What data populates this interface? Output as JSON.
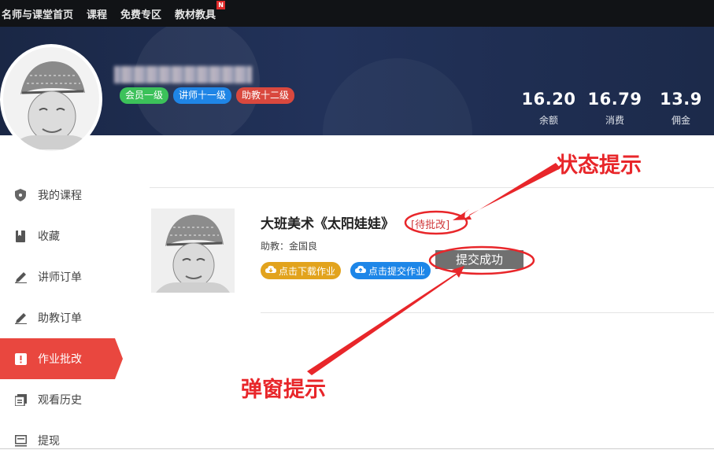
{
  "nav": {
    "items": [
      "名师与课堂首页",
      "课程",
      "免费专区",
      "教材教具"
    ],
    "new_badge": "N"
  },
  "profile": {
    "badges": [
      "会员一级",
      "讲师十一级",
      "助教十二级"
    ]
  },
  "stats": [
    {
      "value": "16.20",
      "label": "余额"
    },
    {
      "value": "16.79",
      "label": "消费"
    },
    {
      "value": "13.9",
      "label": "佣金"
    }
  ],
  "sidebar": {
    "items": [
      {
        "label": "我的课程",
        "icon": "shield-icon"
      },
      {
        "label": "收藏",
        "icon": "bookmark-icon"
      },
      {
        "label": "讲师订单",
        "icon": "pencil-icon"
      },
      {
        "label": "助教订单",
        "icon": "pencil-icon"
      },
      {
        "label": "作业批改",
        "icon": "alert-icon",
        "active": true
      },
      {
        "label": "观看历史",
        "icon": "history-icon"
      },
      {
        "label": "提现",
        "icon": "withdraw-icon"
      }
    ]
  },
  "course": {
    "title": "大班美术《太阳娃娃》",
    "status": "[待批改]",
    "assistant": "助教：金国良",
    "download_label": "点击下载作业",
    "submit_label": "点击提交作业",
    "toast": "提交成功"
  },
  "annotations": {
    "status_hint": "状态提示",
    "popup_hint": "弹窗提示",
    "color": "#e8262a"
  },
  "colors": {
    "nav_bg": "#111316",
    "banner_bg": "#1f2d52",
    "active_red": "#e9473f",
    "orange_button": "#e2a31d",
    "blue_button": "#1d86e8",
    "toast_bg": "#707070"
  }
}
